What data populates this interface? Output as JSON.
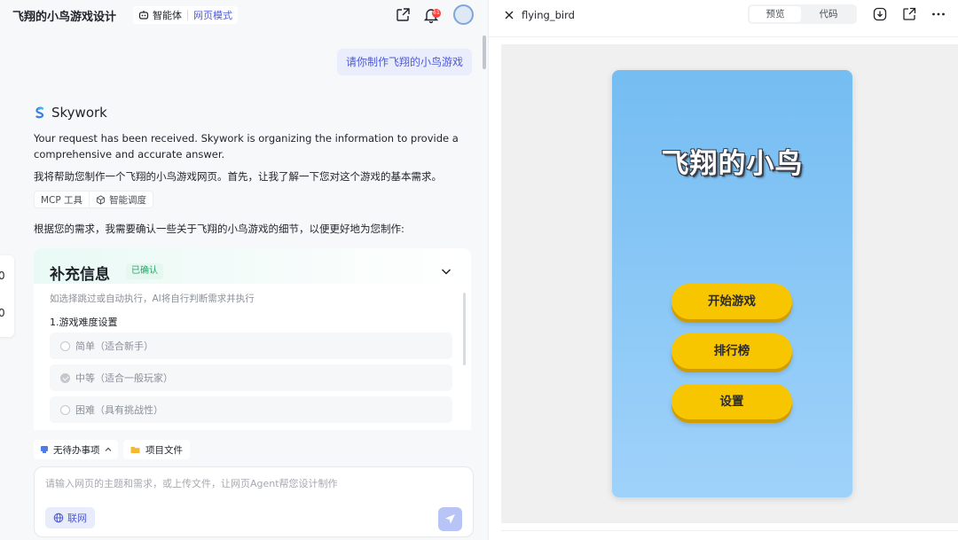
{
  "header": {
    "project_title": "飞翔的小鸟游戏设计",
    "agent_label": "智能体",
    "mode_label": "网页模式",
    "notification_count": "61"
  },
  "chat": {
    "user_message": "请你制作飞翔的小鸟游戏",
    "assistant_name": "Skywork",
    "line1": "Your request has been received. Skywork is organizing the information to provide a",
    "line2": "comprehensive and accurate answer.",
    "line3": "我将帮助您制作一个飞翔的小鸟游戏网页。首先，让我了解一下您对这个游戏的基本需求。",
    "chip_mcp": "MCP 工具",
    "chip_schedule": "智能调度",
    "line4": "根据您的需求，我需要确认一些关于飞翔的小鸟游戏的细节，以便更好地为您制作:"
  },
  "info_card": {
    "title": "补充信息",
    "status": "已确认",
    "subtitle": "如选择跳过或自动执行，AI将自行判断需求并执行",
    "question": "1.游戏难度设置",
    "options": [
      {
        "label": "简单（适合新手）",
        "checked": false
      },
      {
        "label": "中等（适合一般玩家）",
        "checked": true
      },
      {
        "label": "困难（具有挑战性）",
        "checked": false
      }
    ]
  },
  "toolbar": {
    "todo_label": "无待办事项",
    "files_label": "项目文件"
  },
  "composer": {
    "placeholder": "请输入网页的主题和需求，或上传文件，让网页Agent帮您设计制作",
    "web_label": "联网"
  },
  "preview": {
    "file_name": "flying_bird",
    "tab_preview": "预览",
    "tab_code": "代码",
    "game_title": "飞翔的小鸟",
    "buttons": [
      "开始游戏",
      "排行榜",
      "设置"
    ]
  },
  "colors": {
    "accent": "#4f5bd5",
    "game_button": "#f7c600",
    "sky_top": "#75bdf2",
    "sky_bottom": "#9fd2fa"
  }
}
